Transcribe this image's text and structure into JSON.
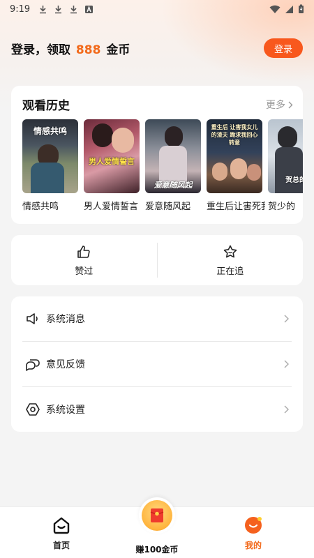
{
  "status_bar": {
    "time": "9:19"
  },
  "header": {
    "login_prefix": "登录，领取",
    "coin_amount": "888",
    "login_suffix": "金币",
    "login_button": "登录"
  },
  "history": {
    "title": "观看历史",
    "more_label": "更多",
    "items": [
      {
        "title": "情感共鸣",
        "poster_text": "情感共鸣"
      },
      {
        "title": "男人爱情誓言",
        "poster_text": "男人爱情誓言"
      },
      {
        "title": "爱意随风起",
        "poster_text": "爱意随风起"
      },
      {
        "title": "重生后让害死我的人",
        "poster_text": "重生后 让害我女儿的渣夫 跪求我回心转意"
      },
      {
        "title": "贺少的",
        "poster_text": "贺总的"
      }
    ]
  },
  "likes": {
    "liked_label": "赞过",
    "following_label": "正在追"
  },
  "settings": {
    "items": [
      {
        "label": "系统消息",
        "icon": "speaker-icon"
      },
      {
        "label": "意见反馈",
        "icon": "chat-bubbles-icon"
      },
      {
        "label": "系统设置",
        "icon": "hexagon-settings-icon"
      }
    ]
  },
  "bottom_nav": {
    "home_label": "首页",
    "earn_label": "赚100金币",
    "mine_label": "我的"
  },
  "colors": {
    "accent": "#f8581d",
    "coin_highlight": "#f26a1b"
  }
}
